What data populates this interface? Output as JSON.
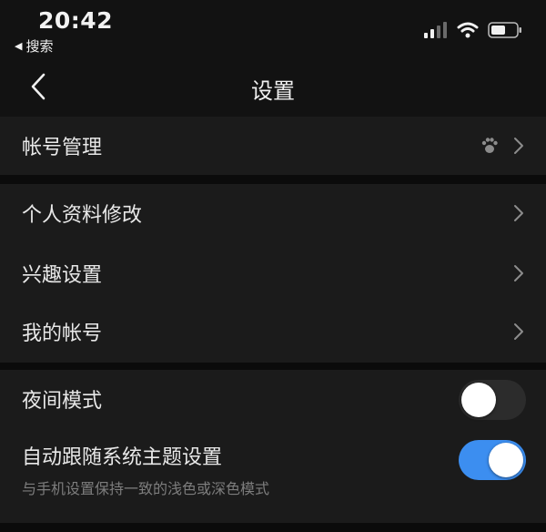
{
  "status_bar": {
    "time": "20:42",
    "back_app": "搜索",
    "icons": [
      "signal-icon",
      "wifi-icon",
      "battery-icon"
    ]
  },
  "nav": {
    "title": "设置",
    "back_icon": "chevron-left-icon"
  },
  "sections": {
    "account": {
      "label": "帐号管理",
      "icon": "paw-icon"
    },
    "profile_items": [
      {
        "label": "个人资料修改"
      },
      {
        "label": "兴趣设置"
      },
      {
        "label": "我的帐号"
      }
    ],
    "display": {
      "night_mode": {
        "label": "夜间模式",
        "enabled": false
      },
      "follow_system": {
        "label": "自动跟随系统主题设置",
        "description": "与手机设置保持一致的浅色或深色模式",
        "enabled": true
      }
    }
  },
  "colors": {
    "background": "#0b0b0b",
    "card": "#1b1b1b",
    "accent": "#3c8ef0",
    "text_primary": "#e8e8e8",
    "text_secondary": "#7d7d7d"
  }
}
